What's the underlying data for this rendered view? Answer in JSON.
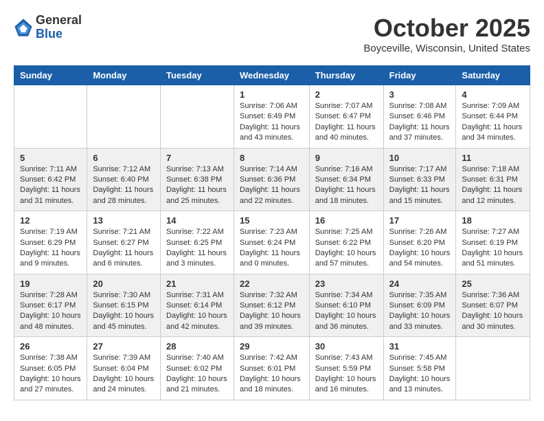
{
  "header": {
    "logo": {
      "general": "General",
      "blue": "Blue"
    },
    "title": "October 2025",
    "location": "Boyceville, Wisconsin, United States"
  },
  "calendar": {
    "days_of_week": [
      "Sunday",
      "Monday",
      "Tuesday",
      "Wednesday",
      "Thursday",
      "Friday",
      "Saturday"
    ],
    "weeks": [
      [
        {
          "day": "",
          "info": ""
        },
        {
          "day": "",
          "info": ""
        },
        {
          "day": "",
          "info": ""
        },
        {
          "day": "1",
          "info": "Sunrise: 7:06 AM\nSunset: 6:49 PM\nDaylight: 11 hours\nand 43 minutes."
        },
        {
          "day": "2",
          "info": "Sunrise: 7:07 AM\nSunset: 6:47 PM\nDaylight: 11 hours\nand 40 minutes."
        },
        {
          "day": "3",
          "info": "Sunrise: 7:08 AM\nSunset: 6:46 PM\nDaylight: 11 hours\nand 37 minutes."
        },
        {
          "day": "4",
          "info": "Sunrise: 7:09 AM\nSunset: 6:44 PM\nDaylight: 11 hours\nand 34 minutes."
        }
      ],
      [
        {
          "day": "5",
          "info": "Sunrise: 7:11 AM\nSunset: 6:42 PM\nDaylight: 11 hours\nand 31 minutes."
        },
        {
          "day": "6",
          "info": "Sunrise: 7:12 AM\nSunset: 6:40 PM\nDaylight: 11 hours\nand 28 minutes."
        },
        {
          "day": "7",
          "info": "Sunrise: 7:13 AM\nSunset: 6:38 PM\nDaylight: 11 hours\nand 25 minutes."
        },
        {
          "day": "8",
          "info": "Sunrise: 7:14 AM\nSunset: 6:36 PM\nDaylight: 11 hours\nand 22 minutes."
        },
        {
          "day": "9",
          "info": "Sunrise: 7:16 AM\nSunset: 6:34 PM\nDaylight: 11 hours\nand 18 minutes."
        },
        {
          "day": "10",
          "info": "Sunrise: 7:17 AM\nSunset: 6:33 PM\nDaylight: 11 hours\nand 15 minutes."
        },
        {
          "day": "11",
          "info": "Sunrise: 7:18 AM\nSunset: 6:31 PM\nDaylight: 11 hours\nand 12 minutes."
        }
      ],
      [
        {
          "day": "12",
          "info": "Sunrise: 7:19 AM\nSunset: 6:29 PM\nDaylight: 11 hours\nand 9 minutes."
        },
        {
          "day": "13",
          "info": "Sunrise: 7:21 AM\nSunset: 6:27 PM\nDaylight: 11 hours\nand 6 minutes."
        },
        {
          "day": "14",
          "info": "Sunrise: 7:22 AM\nSunset: 6:25 PM\nDaylight: 11 hours\nand 3 minutes."
        },
        {
          "day": "15",
          "info": "Sunrise: 7:23 AM\nSunset: 6:24 PM\nDaylight: 11 hours\nand 0 minutes."
        },
        {
          "day": "16",
          "info": "Sunrise: 7:25 AM\nSunset: 6:22 PM\nDaylight: 10 hours\nand 57 minutes."
        },
        {
          "day": "17",
          "info": "Sunrise: 7:26 AM\nSunset: 6:20 PM\nDaylight: 10 hours\nand 54 minutes."
        },
        {
          "day": "18",
          "info": "Sunrise: 7:27 AM\nSunset: 6:19 PM\nDaylight: 10 hours\nand 51 minutes."
        }
      ],
      [
        {
          "day": "19",
          "info": "Sunrise: 7:28 AM\nSunset: 6:17 PM\nDaylight: 10 hours\nand 48 minutes."
        },
        {
          "day": "20",
          "info": "Sunrise: 7:30 AM\nSunset: 6:15 PM\nDaylight: 10 hours\nand 45 minutes."
        },
        {
          "day": "21",
          "info": "Sunrise: 7:31 AM\nSunset: 6:14 PM\nDaylight: 10 hours\nand 42 minutes."
        },
        {
          "day": "22",
          "info": "Sunrise: 7:32 AM\nSunset: 6:12 PM\nDaylight: 10 hours\nand 39 minutes."
        },
        {
          "day": "23",
          "info": "Sunrise: 7:34 AM\nSunset: 6:10 PM\nDaylight: 10 hours\nand 36 minutes."
        },
        {
          "day": "24",
          "info": "Sunrise: 7:35 AM\nSunset: 6:09 PM\nDaylight: 10 hours\nand 33 minutes."
        },
        {
          "day": "25",
          "info": "Sunrise: 7:36 AM\nSunset: 6:07 PM\nDaylight: 10 hours\nand 30 minutes."
        }
      ],
      [
        {
          "day": "26",
          "info": "Sunrise: 7:38 AM\nSunset: 6:05 PM\nDaylight: 10 hours\nand 27 minutes."
        },
        {
          "day": "27",
          "info": "Sunrise: 7:39 AM\nSunset: 6:04 PM\nDaylight: 10 hours\nand 24 minutes."
        },
        {
          "day": "28",
          "info": "Sunrise: 7:40 AM\nSunset: 6:02 PM\nDaylight: 10 hours\nand 21 minutes."
        },
        {
          "day": "29",
          "info": "Sunrise: 7:42 AM\nSunset: 6:01 PM\nDaylight: 10 hours\nand 18 minutes."
        },
        {
          "day": "30",
          "info": "Sunrise: 7:43 AM\nSunset: 5:59 PM\nDaylight: 10 hours\nand 16 minutes."
        },
        {
          "day": "31",
          "info": "Sunrise: 7:45 AM\nSunset: 5:58 PM\nDaylight: 10 hours\nand 13 minutes."
        },
        {
          "day": "",
          "info": ""
        }
      ]
    ]
  }
}
